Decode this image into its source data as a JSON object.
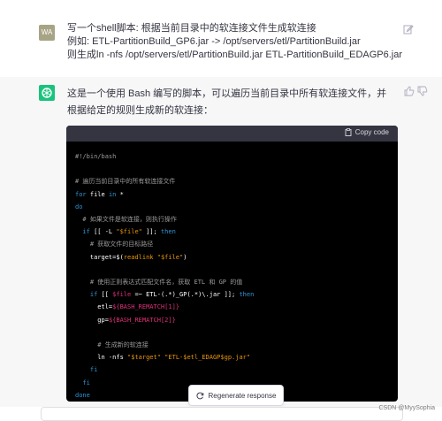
{
  "user": {
    "avatar_initials": "WA",
    "line1": "写一个shell脚本: 根据当前目录中的软连接文件生成软连接",
    "line2": "例如: ETL-PartitionBuild_GP6.jar -> /opt/servers/etl/PartitionBuild.jar",
    "line3": "则生成ln -nfs /opt/servers/etl/PartitionBuild.jar ETL-PartitionBuild_EDAGP6.jar"
  },
  "assistant": {
    "intro": "这是一个使用 Bash 编写的脚本，可以遍历当前目录中所有软连接文件，并根据给定的规则生成新的软连接："
  },
  "code": {
    "copy_label": "Copy code",
    "lines": {
      "l1": "#!/bin/bash",
      "l2": "# 遍历当前目录中的所有软连接文件",
      "l3a": "for",
      "l3b": " file ",
      "l3c": "in",
      "l3d": " *",
      "l4": "do",
      "l5": "  # 如果文件是软连接，则执行操作",
      "l6a": "  if",
      "l6b": " [[ -L ",
      "l6c": "\"$file\"",
      "l6d": " ]]; ",
      "l6e": "then",
      "l7": "    # 获取文件的目标路径",
      "l8a": "    target=$(",
      "l8b": "readlink",
      "l8c": " ",
      "l8d": "\"$file\"",
      "l8e": ")",
      "l9": "    # 使用正则表达式匹配文件名，获取 ETL 和 GP 的值",
      "l10a": "    if",
      "l10b": " [[ ",
      "l10c": "$file",
      "l10d": " =~ ETL-(.*)_GP(.*)\\.jar ]]; ",
      "l10e": "then",
      "l11a": "      etl=",
      "l11b": "${BASH_REMATCH[1]}",
      "l12a": "      gp=",
      "l12b": "${BASH_REMATCH[2]}",
      "l13": "      # 生成新的软连接",
      "l14a": "      ln -nfs ",
      "l14b": "\"$target\"",
      "l14c": " ",
      "l14d": "\"ETL-$etl_EDAGP$gp.jar\"",
      "l15": "    fi",
      "l16": "  fi",
      "l17": "done"
    }
  },
  "regenerate_label": "Regenerate response",
  "watermark": "CSDN @MyySophia",
  "colors": {
    "ai_avatar": "#19c37d",
    "user_avatar": "#a7a385",
    "code_bg": "#000000"
  }
}
